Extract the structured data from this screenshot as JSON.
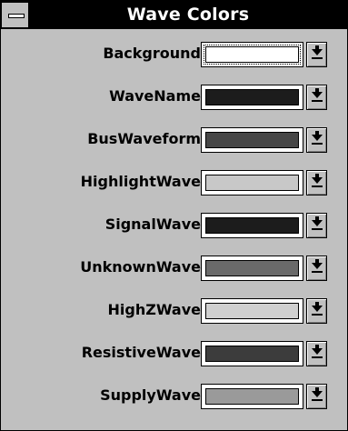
{
  "window": {
    "title": "Wave Colors"
  },
  "rows": [
    {
      "label": "Background",
      "color": "#ffffff",
      "focused": true
    },
    {
      "label": "WaveName",
      "color": "#1c1c1c"
    },
    {
      "label": "BusWaveform",
      "color": "#474747"
    },
    {
      "label": "HighlightWave",
      "color": "#c8c8c8"
    },
    {
      "label": "SignalWave",
      "color": "#1c1c1c"
    },
    {
      "label": "UnknownWave",
      "color": "#6a6a6a"
    },
    {
      "label": "HighZWave",
      "color": "#d0d0d0"
    },
    {
      "label": "ResistiveWave",
      "color": "#3c3c3c"
    },
    {
      "label": "SupplyWave",
      "color": "#9a9a9a"
    }
  ]
}
